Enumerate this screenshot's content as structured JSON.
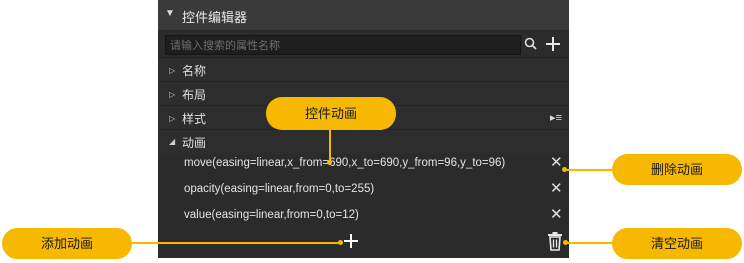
{
  "editor": {
    "title": "控件编辑器",
    "search_placeholder": "请输入搜索的属性名称",
    "sections": {
      "name": "名称",
      "layout": "布局",
      "style": "样式",
      "animation": "动画"
    },
    "animations": [
      "move(easing=linear,x_from=690,x_to=690,y_from=96,y_to=96)",
      "opacity(easing=linear,from=0,to=255)",
      "value(easing=linear,from=0,to=12)"
    ],
    "icons": {
      "collapse": "caret-down-icon",
      "search": "search-icon",
      "add": "plus-icon",
      "delete": "close-icon",
      "clear": "trash-icon",
      "menu": "list-menu-icon"
    }
  },
  "callouts": {
    "widget_animation": "控件动画",
    "delete_animation": "删除动画",
    "add_animation": "添加动画",
    "clear_animation": "清空动画"
  },
  "colors": {
    "callout": "#f6b800",
    "panel": "#2b2b2b",
    "header": "#3a3a3a"
  }
}
